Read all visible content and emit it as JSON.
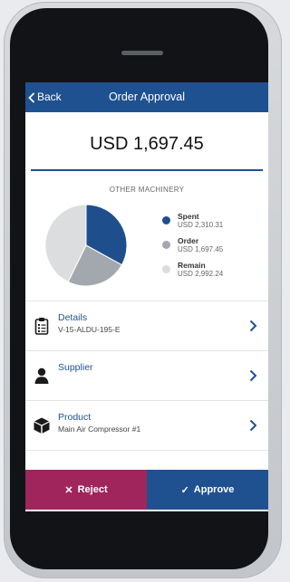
{
  "nav": {
    "back_label": "Back",
    "title": "Order Approval"
  },
  "amount": "USD 1,697.45",
  "section_label": "OTHER MACHINERY",
  "chart_data": {
    "type": "pie",
    "slices": [
      {
        "label": "Spent",
        "value": 2310.31,
        "color": "#1f4e8c"
      },
      {
        "label": "Order",
        "value": 1697.45,
        "color": "#a2a8ae"
      },
      {
        "label": "Remain",
        "value": 2992.24,
        "color": "#dcdddf"
      }
    ]
  },
  "legend": [
    {
      "name": "Spent",
      "value": "USD 2,310.31",
      "color": "#1f4e8c"
    },
    {
      "name": "Order",
      "value": "USD 1,697.45",
      "color": "#a2a8ae"
    },
    {
      "name": "Remain",
      "value": "USD 2,992.24",
      "color": "#dcdddf"
    }
  ],
  "rows": [
    {
      "title": "Details",
      "subtitle": "V-15-ALDU-195-E",
      "icon": "clipboard-icon"
    },
    {
      "title": "Supplier",
      "subtitle": "",
      "icon": "person-icon"
    },
    {
      "title": "Product",
      "subtitle": "Main Air Compressor #1",
      "icon": "box-icon"
    }
  ],
  "actions": {
    "reject_label": "Reject",
    "reject_glyph": "✕",
    "approve_label": "Approve",
    "approve_glyph": "✓"
  },
  "colors": {
    "primary": "#1f5191",
    "reject": "#a0255c"
  }
}
